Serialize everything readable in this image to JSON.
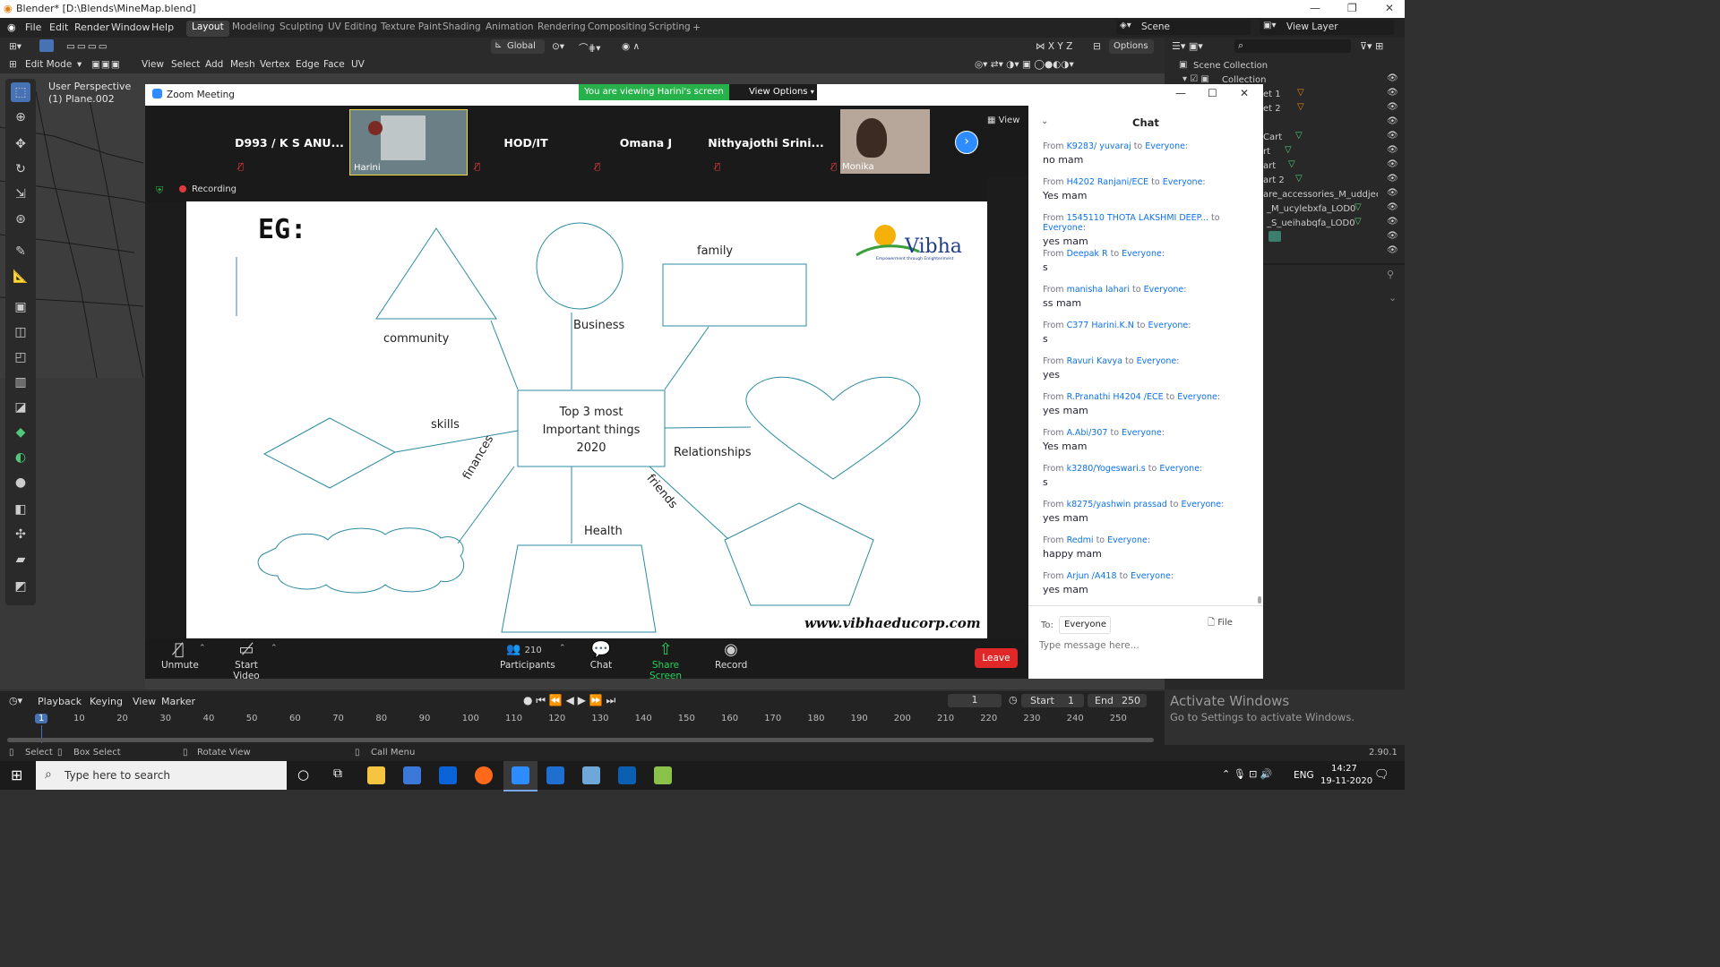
{
  "blender": {
    "window_title": "Blender* [D:\\Blends\\MineMap.blend]",
    "menus": [
      "File",
      "Edit",
      "Render",
      "Window",
      "Help"
    ],
    "workspaces": [
      "Layout",
      "Modeling",
      "Sculpting",
      "UV Editing",
      "Texture Paint",
      "Shading",
      "Animation",
      "Rendering",
      "Compositing",
      "Scripting"
    ],
    "active_workspace": "Layout",
    "scene": "Scene",
    "view_layer": "View Layer",
    "transform_orientation": "Global",
    "options_label": "Options",
    "mode": "Edit Mode",
    "header_menus": [
      "View",
      "Select",
      "Add",
      "Mesh",
      "Vertex",
      "Edge",
      "Face",
      "UV"
    ],
    "viewport_title": "User Perspective",
    "viewport_object": "(1) Plane.002",
    "outliner": {
      "scene_collection": "Scene Collection",
      "collection": "Collection",
      "items": [
        "et 1",
        "et 2",
        "Cart",
        "rt",
        "art",
        "art 2",
        "are_accessories_M_uddjeelqx_LO",
        "_M_ucylebxfa_LOD0",
        "_S_ueihabqfa_LOD0"
      ]
    },
    "timeline": {
      "menus": [
        "Playback",
        "Keying",
        "View",
        "Marker"
      ],
      "current_frame": "1",
      "start_label": "Start",
      "start": "1",
      "end_label": "End",
      "end": "250",
      "ruler": [
        "1",
        "10",
        "20",
        "30",
        "40",
        "50",
        "60",
        "70",
        "80",
        "90",
        "100",
        "110",
        "120",
        "130",
        "140",
        "150",
        "160",
        "170",
        "180",
        "190",
        "200",
        "210",
        "220",
        "230",
        "240",
        "250"
      ]
    },
    "status": {
      "select": "Select",
      "box_select": "Box Select",
      "rotate_view": "Rotate View",
      "call_menu": "Call Menu",
      "version": "2.90.1"
    },
    "activate_windows": {
      "title": "Activate Windows",
      "subtitle": "Go to Settings to activate Windows."
    }
  },
  "zoom": {
    "title": "Zoom Meeting",
    "viewing_banner": "You are viewing Harini's screen",
    "view_options": "View Options",
    "gallery_view": "View",
    "participants": [
      {
        "name": "D993 / K S ANU...",
        "video": false
      },
      {
        "name": "Harini",
        "video": true
      },
      {
        "name": "HOD/IT",
        "video": false
      },
      {
        "name": "Omana J",
        "video": false
      },
      {
        "name": "Nithyajothi  Srini...",
        "video": false
      },
      {
        "name": "Monika",
        "video": true
      }
    ],
    "recording_label": "Recording",
    "controls": {
      "unmute": "Unmute",
      "start_video": "Start Video",
      "participants": "Participants",
      "participant_count": "210",
      "chat": "Chat",
      "share_screen": "Share Screen",
      "record": "Record",
      "leave": "Leave"
    },
    "slide": {
      "eg": "EG:",
      "center": [
        "Top 3 most",
        "Important things",
        "2020"
      ],
      "labels": {
        "community": "community",
        "business": "Business",
        "family": "family",
        "skills": "skills",
        "relationships": "Relationships",
        "finances": "finances",
        "friends": "friends",
        "health": "Health"
      },
      "logo_text": "Vibha",
      "logo_tagline": "Empowerment through Enlightenment",
      "website": "www.vibhaeducorp.com"
    },
    "chat": {
      "title": "Chat",
      "messages": [
        {
          "from": "K9283/ yuvaraj",
          "to": "Everyone",
          "text": "no mam"
        },
        {
          "from": "H4202 Ranjani/ECE",
          "to": "Everyone",
          "text": "Yes mam"
        },
        {
          "from": "1545110 THOTA LAKSHMI DEEP...",
          "to": "Everyone",
          "text": "yes mam"
        },
        {
          "from": "Deepak R",
          "to": "Everyone",
          "text": "s"
        },
        {
          "from": "manisha lahari",
          "to": "Everyone",
          "text": "ss mam"
        },
        {
          "from": "C377 Harini.K.N",
          "to": "Everyone",
          "text": "s"
        },
        {
          "from": "Ravuri Kavya",
          "to": "Everyone",
          "text": "yes"
        },
        {
          "from": "R.Pranathi  H4204 /ECE",
          "to": "Everyone",
          "text": "yes mam"
        },
        {
          "from": "A.Abi/307",
          "to": "Everyone",
          "text": "Yes mam"
        },
        {
          "from": "k3280/Yogeswari.s",
          "to": "Everyone",
          "text": "s"
        },
        {
          "from": "k8275/yashwin prassad",
          "to": "Everyone",
          "text": "yes mam"
        },
        {
          "from": "Redmi",
          "to": "Everyone",
          "text": "happy mam"
        },
        {
          "from": "Arjun /A418",
          "to": "Everyone",
          "text": "yes mam"
        }
      ],
      "from_word": "From",
      "to_word": "to",
      "to_label": "To:",
      "to_value": "Everyone",
      "file_label": "File",
      "input_placeholder": "Type message here..."
    }
  },
  "taskbar": {
    "search_placeholder": "Type here to search",
    "lang": "ENG",
    "time": "14:27",
    "date": "19-11-2020"
  }
}
